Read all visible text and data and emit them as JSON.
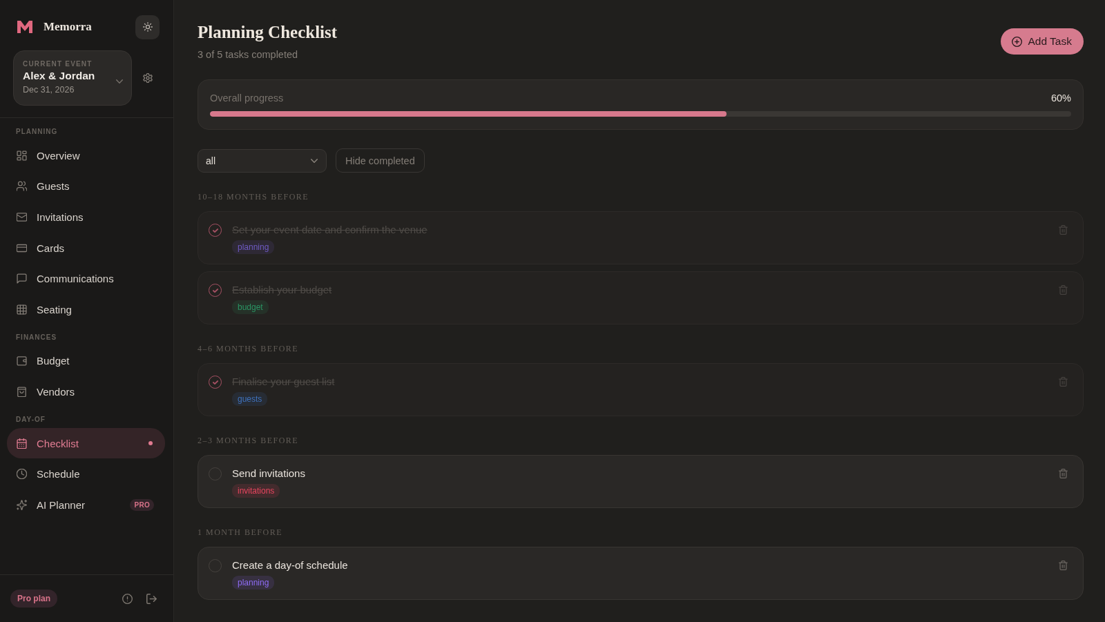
{
  "sidebar": {
    "brand": "Memorra",
    "event": {
      "label": "CURRENT EVENT",
      "name": "Alex & Jordan",
      "date": "Dec 31, 2026"
    },
    "sections": [
      {
        "title": "PLANNING",
        "items": [
          {
            "label": "Overview",
            "selected": false
          },
          {
            "label": "Guests",
            "selected": false
          },
          {
            "label": "Invitations",
            "selected": false
          },
          {
            "label": "Cards",
            "selected": false
          },
          {
            "label": "Communications",
            "selected": false
          },
          {
            "label": "Seating",
            "selected": false
          }
        ]
      },
      {
        "title": "FINANCES",
        "items": [
          {
            "label": "Budget",
            "selected": false
          },
          {
            "label": "Vendors",
            "selected": false
          }
        ]
      },
      {
        "title": "DAY-OF",
        "items": [
          {
            "label": "Checklist",
            "selected": true
          },
          {
            "label": "Schedule",
            "selected": false
          },
          {
            "label": "AI Planner",
            "selected": false,
            "badge": "PRO"
          }
        ]
      }
    ],
    "plan": "Pro plan"
  },
  "header": {
    "title": "Planning Checklist",
    "subtitle": "3 of 5 tasks completed",
    "add_button": "Add Task"
  },
  "progress": {
    "label": "Overall progress",
    "reading": "60%",
    "level": 0.6
  },
  "filters": {
    "select_value": "all",
    "hide_button": "Hide completed"
  },
  "groups": [
    {
      "title": "10–18 MONTHS BEFORE",
      "tasks": [
        {
          "title": "Set your event date and confirm the venue",
          "tag": "planning",
          "color": "#6f5ac4",
          "checked": true
        },
        {
          "title": "Establish your budget",
          "tag": "budget",
          "color": "#2a9463",
          "checked": true
        }
      ]
    },
    {
      "title": "4–6 MONTHS BEFORE",
      "tasks": [
        {
          "title": "Finalise your guest list",
          "tag": "guests",
          "color": "#3f72bd",
          "checked": true
        }
      ]
    },
    {
      "title": "2–3 MONTHS BEFORE",
      "tasks": [
        {
          "title": "Send invitations",
          "tag": "invitations",
          "color": "#e8465f",
          "checked": false
        }
      ]
    },
    {
      "title": "1 MONTH BEFORE",
      "tasks": [
        {
          "title": "Create a day-of schedule",
          "tag": "planning",
          "color": "#8f6cf5",
          "checked": false
        }
      ]
    }
  ]
}
